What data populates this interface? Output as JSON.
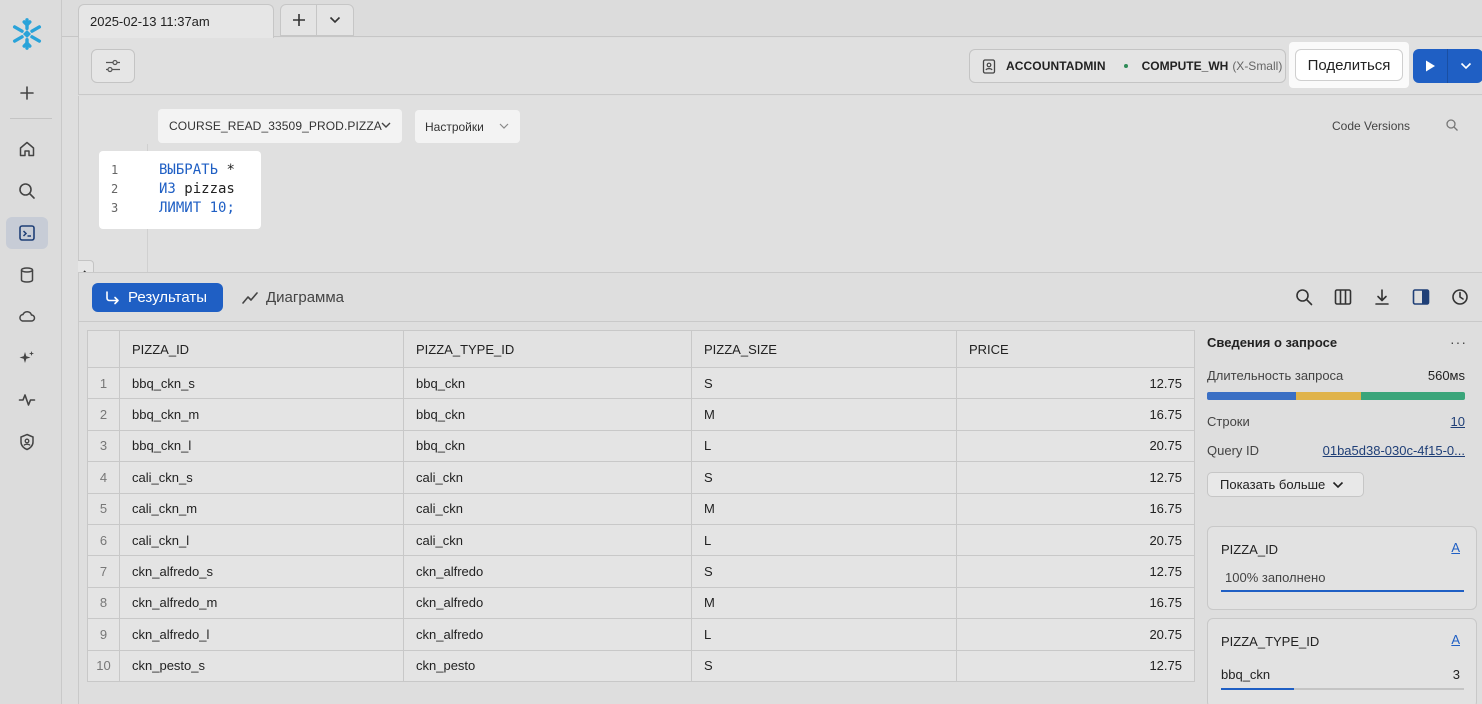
{
  "tab": {
    "title": "2025-02-13 11:37am"
  },
  "toolbar": {
    "role": "ACCOUNTADMIN",
    "warehouse": "COMPUTE_WH",
    "warehouse_size": "(X-Small)",
    "share_label": "Поделиться"
  },
  "editor": {
    "database": "COURSE_READ_33509_PROD.PIZZA",
    "settings_label": "Настройки",
    "code_versions_label": "Code Versions",
    "lines": [
      {
        "num": "1",
        "kw": "ВЫБРАТЬ",
        "rest": " *",
        "lit": ""
      },
      {
        "num": "2",
        "kw": "ИЗ",
        "rest": " pizzas",
        "lit": ""
      },
      {
        "num": "3",
        "kw": "ЛИМИТ",
        "rest": " ",
        "lit": "10;"
      }
    ]
  },
  "results": {
    "tab_results": "Результаты",
    "tab_chart": "Диаграмма",
    "columns": [
      "PIZZA_ID",
      "PIZZA_TYPE_ID",
      "PIZZA_SIZE",
      "PRICE"
    ],
    "rows": [
      [
        "1",
        "bbq_ckn_s",
        "bbq_ckn",
        "S",
        "12.75"
      ],
      [
        "2",
        "bbq_ckn_m",
        "bbq_ckn",
        "M",
        "16.75"
      ],
      [
        "3",
        "bbq_ckn_l",
        "bbq_ckn",
        "L",
        "20.75"
      ],
      [
        "4",
        "cali_ckn_s",
        "cali_ckn",
        "S",
        "12.75"
      ],
      [
        "5",
        "cali_ckn_m",
        "cali_ckn",
        "M",
        "16.75"
      ],
      [
        "6",
        "cali_ckn_l",
        "cali_ckn",
        "L",
        "20.75"
      ],
      [
        "7",
        "ckn_alfredo_s",
        "ckn_alfredo",
        "S",
        "12.75"
      ],
      [
        "8",
        "ckn_alfredo_m",
        "ckn_alfredo",
        "M",
        "16.75"
      ],
      [
        "9",
        "ckn_alfredo_l",
        "ckn_alfredo",
        "L",
        "20.75"
      ],
      [
        "10",
        "ckn_pesto_s",
        "ckn_pesto",
        "S",
        "12.75"
      ]
    ]
  },
  "details": {
    "title": "Сведения о запросе",
    "duration_label": "Длительность запроса",
    "duration_value": "560мs",
    "duration_segments": [
      {
        "color": "#3a6fc4",
        "fraction": 0.345
      },
      {
        "color": "#e0b34a",
        "fraction": 0.25
      },
      {
        "color": "#3aa57a",
        "fraction": 0.405
      }
    ],
    "rows_label": "Строки",
    "rows_value": "10",
    "query_id_label": "Query ID",
    "query_id_value": "01ba5d38-030c-4f15-0...",
    "show_more_label": "Показать больше",
    "col_cards": [
      {
        "name": "PIZZA_ID",
        "type_badge": "A",
        "fill_text": "100% заполнено",
        "fill_fraction": 1.0
      },
      {
        "name": "PIZZA_TYPE_ID",
        "type_badge": "A",
        "stat_label": "bbq_ckn",
        "stat_value": "3",
        "fill_fraction": 0.3
      }
    ]
  },
  "colors": {
    "accent": "#1f5fc4",
    "background": "#dedede"
  }
}
